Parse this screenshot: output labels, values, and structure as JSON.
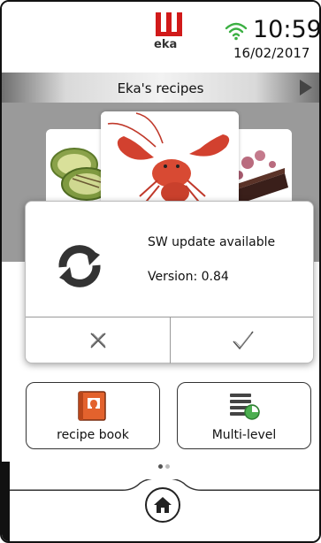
{
  "status_bar": {
    "brand": "eka",
    "time": "10:59",
    "date": "16/02/2017",
    "icons": {
      "wifi": "wifi-icon"
    }
  },
  "header": {
    "title": "Eka's recipes",
    "arrow_icon": "arrow-right-icon"
  },
  "carousel": {
    "items": [
      {
        "icon": "zucchini-image"
      },
      {
        "icon": "lobster-image"
      },
      {
        "icon": "dessert-image"
      }
    ]
  },
  "dialog": {
    "title": "SW update available",
    "version": "Version: 0.84",
    "icon": "refresh-icon",
    "cancel_icon": "close-icon",
    "confirm_icon": "checkmark-icon"
  },
  "tiles": [
    {
      "label": "recipe book",
      "icon": "recipe-book-icon"
    },
    {
      "label": "Multi-level",
      "icon": "multi-level-icon"
    }
  ],
  "pager": {
    "pages": 2,
    "current": 1
  },
  "nav": {
    "home_icon": "home-icon"
  },
  "colors": {
    "brand_red": "#d11a1a",
    "wifi_green": "#3cb043",
    "multi_level_green": "#4caf50",
    "book_orange": "#e3622d",
    "carousel_grey": "#9a9a9a"
  }
}
